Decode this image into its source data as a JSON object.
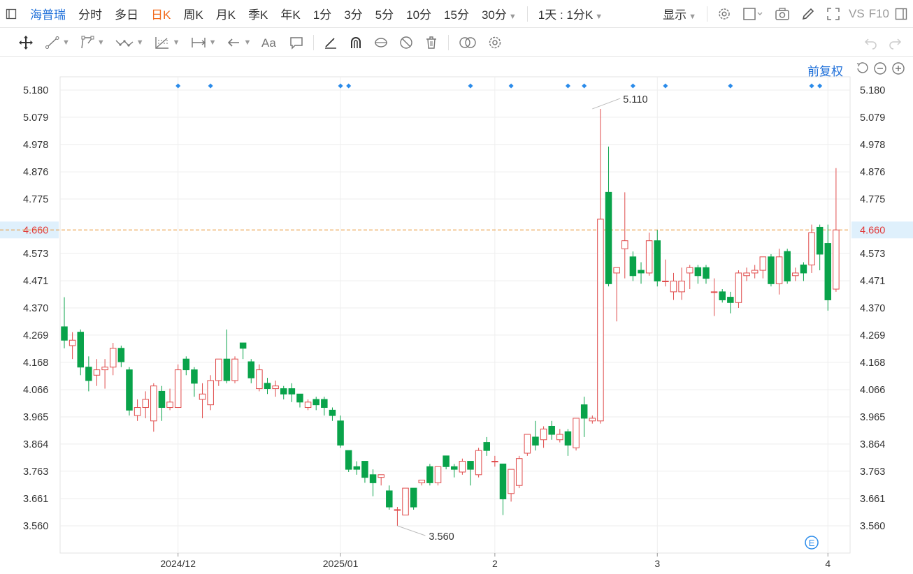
{
  "topbar": {
    "stock_name": "海普瑞",
    "periods": [
      "分时",
      "多日",
      "日K",
      "周K",
      "月K",
      "季K",
      "年K",
      "1分",
      "3分",
      "5分",
      "10分",
      "15分"
    ],
    "active_period": "日K",
    "period_30": "30分",
    "interval": "1天 : 1分K",
    "display": "显示",
    "vs": "VS",
    "f10": "F10"
  },
  "chart_header": {
    "adjust": "前复权"
  },
  "colors": {
    "up": "#e04b4b",
    "down": "#09a34a",
    "last": "#e8912d",
    "accent": "#1e6fd9"
  },
  "chart_data": {
    "type": "candlestick",
    "y_ticks": [
      "5.180",
      "5.079",
      "4.978",
      "4.876",
      "4.775",
      "4.660",
      "4.573",
      "4.471",
      "4.370",
      "4.269",
      "4.168",
      "4.066",
      "3.965",
      "3.864",
      "3.763",
      "3.661",
      "3.560"
    ],
    "ylim": [
      3.5,
      5.18
    ],
    "last_price": "4.660",
    "last_price_value": 4.66,
    "x_labels": [
      {
        "label": "2024/12",
        "index": 14
      },
      {
        "label": "2025/01",
        "index": 34
      },
      {
        "label": "2",
        "index": 53
      },
      {
        "label": "3",
        "index": 73
      },
      {
        "label": "4",
        "index": 94
      }
    ],
    "max_label": "5.110",
    "max_index": 65,
    "max_value": 5.11,
    "min_label": "3.560",
    "min_index": 41,
    "min_value": 3.56,
    "event_marker": "E",
    "event_index": 92,
    "marker_indices": [
      14,
      18,
      34,
      35,
      50,
      55,
      62,
      64,
      70,
      74,
      82,
      92,
      93
    ],
    "candles": [
      [
        4.3,
        4.25,
        4.41,
        4.22
      ],
      [
        4.23,
        4.25,
        4.28,
        4.18
      ],
      [
        4.28,
        4.15,
        4.29,
        4.12
      ],
      [
        4.15,
        4.1,
        4.19,
        4.06
      ],
      [
        4.12,
        4.14,
        4.18,
        4.08
      ],
      [
        4.14,
        4.15,
        4.18,
        4.07
      ],
      [
        4.15,
        4.22,
        4.24,
        4.12
      ],
      [
        4.22,
        4.17,
        4.23,
        4.15
      ],
      [
        4.14,
        3.99,
        4.15,
        3.97
      ],
      [
        3.97,
        4.0,
        4.03,
        3.95
      ],
      [
        4.0,
        4.03,
        4.06,
        3.96
      ],
      [
        3.95,
        4.08,
        4.09,
        3.91
      ],
      [
        4.06,
        4.0,
        4.08,
        3.95
      ],
      [
        4.0,
        4.02,
        4.07,
        3.99
      ],
      [
        4.0,
        4.14,
        4.16,
        4.0
      ],
      [
        4.18,
        4.14,
        4.19,
        4.12
      ],
      [
        4.14,
        4.09,
        4.15,
        4.04
      ],
      [
        4.03,
        4.05,
        4.09,
        3.96
      ],
      [
        4.01,
        4.1,
        4.12,
        3.99
      ],
      [
        4.1,
        4.18,
        4.18,
        4.08
      ],
      [
        4.18,
        4.1,
        4.29,
        4.09
      ],
      [
        4.1,
        4.18,
        4.19,
        4.09
      ],
      [
        4.24,
        4.22,
        4.24,
        4.18
      ],
      [
        4.17,
        4.11,
        4.18,
        4.09
      ],
      [
        4.07,
        4.14,
        4.16,
        4.06
      ],
      [
        4.09,
        4.07,
        4.11,
        4.05
      ],
      [
        4.07,
        4.08,
        4.1,
        4.04
      ],
      [
        4.07,
        4.05,
        4.08,
        4.03
      ],
      [
        4.07,
        4.05,
        4.09,
        4.02
      ],
      [
        4.05,
        4.02,
        4.05,
        4.0
      ],
      [
        4.0,
        4.02,
        4.03,
        3.99
      ],
      [
        4.03,
        4.01,
        4.04,
        3.99
      ],
      [
        4.03,
        4.0,
        4.04,
        3.97
      ],
      [
        3.99,
        3.97,
        4.0,
        3.95
      ],
      [
        3.95,
        3.86,
        3.97,
        3.85
      ],
      [
        3.84,
        3.77,
        3.84,
        3.76
      ],
      [
        3.78,
        3.77,
        3.8,
        3.75
      ],
      [
        3.8,
        3.74,
        3.8,
        3.72
      ],
      [
        3.75,
        3.72,
        3.77,
        3.67
      ],
      [
        3.74,
        3.75,
        3.75,
        3.71
      ],
      [
        3.69,
        3.63,
        3.71,
        3.62
      ],
      [
        3.62,
        3.62,
        3.63,
        3.56
      ],
      [
        3.6,
        3.7,
        3.7,
        3.6
      ],
      [
        3.7,
        3.63,
        3.7,
        3.62
      ],
      [
        3.72,
        3.73,
        3.73,
        3.71
      ],
      [
        3.78,
        3.72,
        3.79,
        3.71
      ],
      [
        3.72,
        3.78,
        3.78,
        3.71
      ],
      [
        3.82,
        3.78,
        3.82,
        3.77
      ],
      [
        3.78,
        3.77,
        3.79,
        3.74
      ],
      [
        3.76,
        3.8,
        3.81,
        3.75
      ],
      [
        3.8,
        3.77,
        3.8,
        3.71
      ],
      [
        3.75,
        3.84,
        3.85,
        3.74
      ],
      [
        3.87,
        3.84,
        3.89,
        3.82
      ],
      [
        3.8,
        3.8,
        3.82,
        3.78
      ],
      [
        3.79,
        3.66,
        3.79,
        3.6
      ],
      [
        3.68,
        3.77,
        3.77,
        3.65
      ],
      [
        3.71,
        3.81,
        3.82,
        3.7
      ],
      [
        3.83,
        3.9,
        3.9,
        3.82
      ],
      [
        3.89,
        3.86,
        3.95,
        3.84
      ],
      [
        3.88,
        3.92,
        3.93,
        3.85
      ],
      [
        3.93,
        3.9,
        3.95,
        3.88
      ],
      [
        3.88,
        3.9,
        3.92,
        3.87
      ],
      [
        3.91,
        3.86,
        3.92,
        3.82
      ],
      [
        3.85,
        3.96,
        3.96,
        3.84
      ],
      [
        4.01,
        3.96,
        4.04,
        3.89
      ],
      [
        3.95,
        3.96,
        3.97,
        3.94
      ],
      [
        3.95,
        4.7,
        5.11,
        3.94
      ],
      [
        4.8,
        4.46,
        4.97,
        4.45
      ],
      [
        4.5,
        4.52,
        4.52,
        4.32
      ],
      [
        4.59,
        4.62,
        4.8,
        4.48
      ],
      [
        4.56,
        4.49,
        4.58,
        4.47
      ],
      [
        4.51,
        4.5,
        4.54,
        4.46
      ],
      [
        4.5,
        4.62,
        4.65,
        4.49
      ],
      [
        4.62,
        4.47,
        4.66,
        4.45
      ],
      [
        4.47,
        4.47,
        4.55,
        4.45
      ],
      [
        4.43,
        4.47,
        4.5,
        4.4
      ],
      [
        4.43,
        4.47,
        4.52,
        4.4
      ],
      [
        4.5,
        4.52,
        4.53,
        4.44
      ],
      [
        4.52,
        4.49,
        4.53,
        4.46
      ],
      [
        4.52,
        4.48,
        4.53,
        4.46
      ],
      [
        4.43,
        4.43,
        4.48,
        4.34
      ],
      [
        4.43,
        4.4,
        4.44,
        4.39
      ],
      [
        4.41,
        4.39,
        4.43,
        4.35
      ],
      [
        4.39,
        4.5,
        4.51,
        4.37
      ],
      [
        4.49,
        4.5,
        4.52,
        4.47
      ],
      [
        4.5,
        4.51,
        4.53,
        4.48
      ],
      [
        4.51,
        4.56,
        4.56,
        4.48
      ],
      [
        4.56,
        4.46,
        4.57,
        4.45
      ],
      [
        4.46,
        4.56,
        4.59,
        4.42
      ],
      [
        4.58,
        4.47,
        4.59,
        4.46
      ],
      [
        4.49,
        4.5,
        4.52,
        4.47
      ],
      [
        4.53,
        4.5,
        4.54,
        4.47
      ],
      [
        4.53,
        4.65,
        4.68,
        4.5
      ],
      [
        4.67,
        4.57,
        4.68,
        4.51
      ],
      [
        4.61,
        4.4,
        4.68,
        4.36
      ],
      [
        4.44,
        4.66,
        4.89,
        4.43
      ]
    ]
  }
}
